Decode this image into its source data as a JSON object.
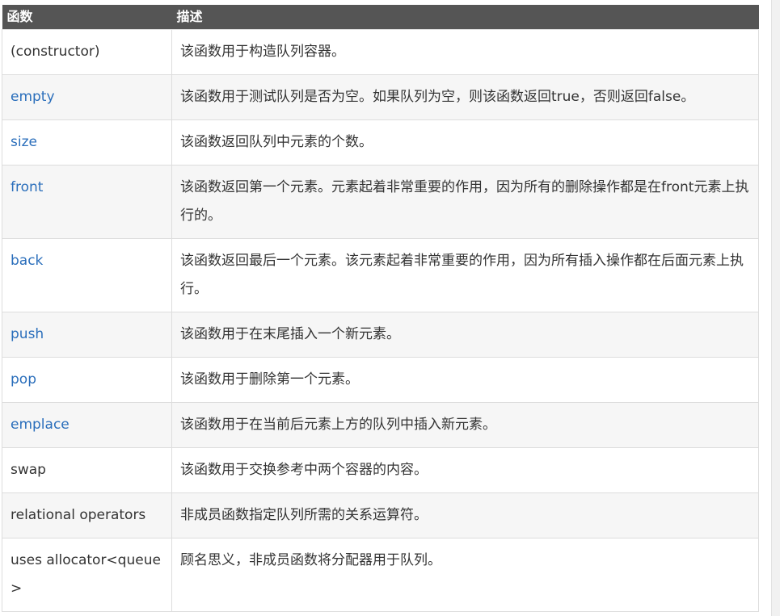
{
  "table": {
    "headers": [
      "函数",
      "描述"
    ],
    "rows": [
      {
        "function": "(constructor)",
        "link": false,
        "description": "该函数用于构造队列容器。"
      },
      {
        "function": "empty",
        "link": true,
        "description": "该函数用于测试队列是否为空。如果队列为空，则该函数返回true，否则返回false。"
      },
      {
        "function": "size",
        "link": true,
        "description": "该函数返回队列中元素的个数。"
      },
      {
        "function": "front",
        "link": true,
        "description": "该函数返回第一个元素。元素起着非常重要的作用，因为所有的删除操作都是在front元素上执行的。"
      },
      {
        "function": "back",
        "link": true,
        "description": "该函数返回最后一个元素。该元素起着非常重要的作用，因为所有插入操作都在后面元素上执行。"
      },
      {
        "function": "push",
        "link": true,
        "description": "该函数用于在末尾插入一个新元素。"
      },
      {
        "function": "pop",
        "link": true,
        "description": "该函数用于删除第一个元素。"
      },
      {
        "function": "emplace",
        "link": true,
        "description": "该函数用于在当前后元素上方的队列中插入新元素。"
      },
      {
        "function": "swap",
        "link": false,
        "description": "该函数用于交换参考中两个容器的内容。"
      },
      {
        "function": "relational operators",
        "link": false,
        "description": "非成员函数指定队列所需的关系运算符。"
      },
      {
        "function": "uses allocator<queue>",
        "link": false,
        "description": "顾名思义，非成员函数将分配器用于队列。"
      }
    ]
  },
  "colors": {
    "header_bg": "#555555",
    "header_text": "#ffffff",
    "link": "#2a6ebb",
    "row_alt_bg": "#f6f6f6",
    "border": "#dddddd"
  }
}
